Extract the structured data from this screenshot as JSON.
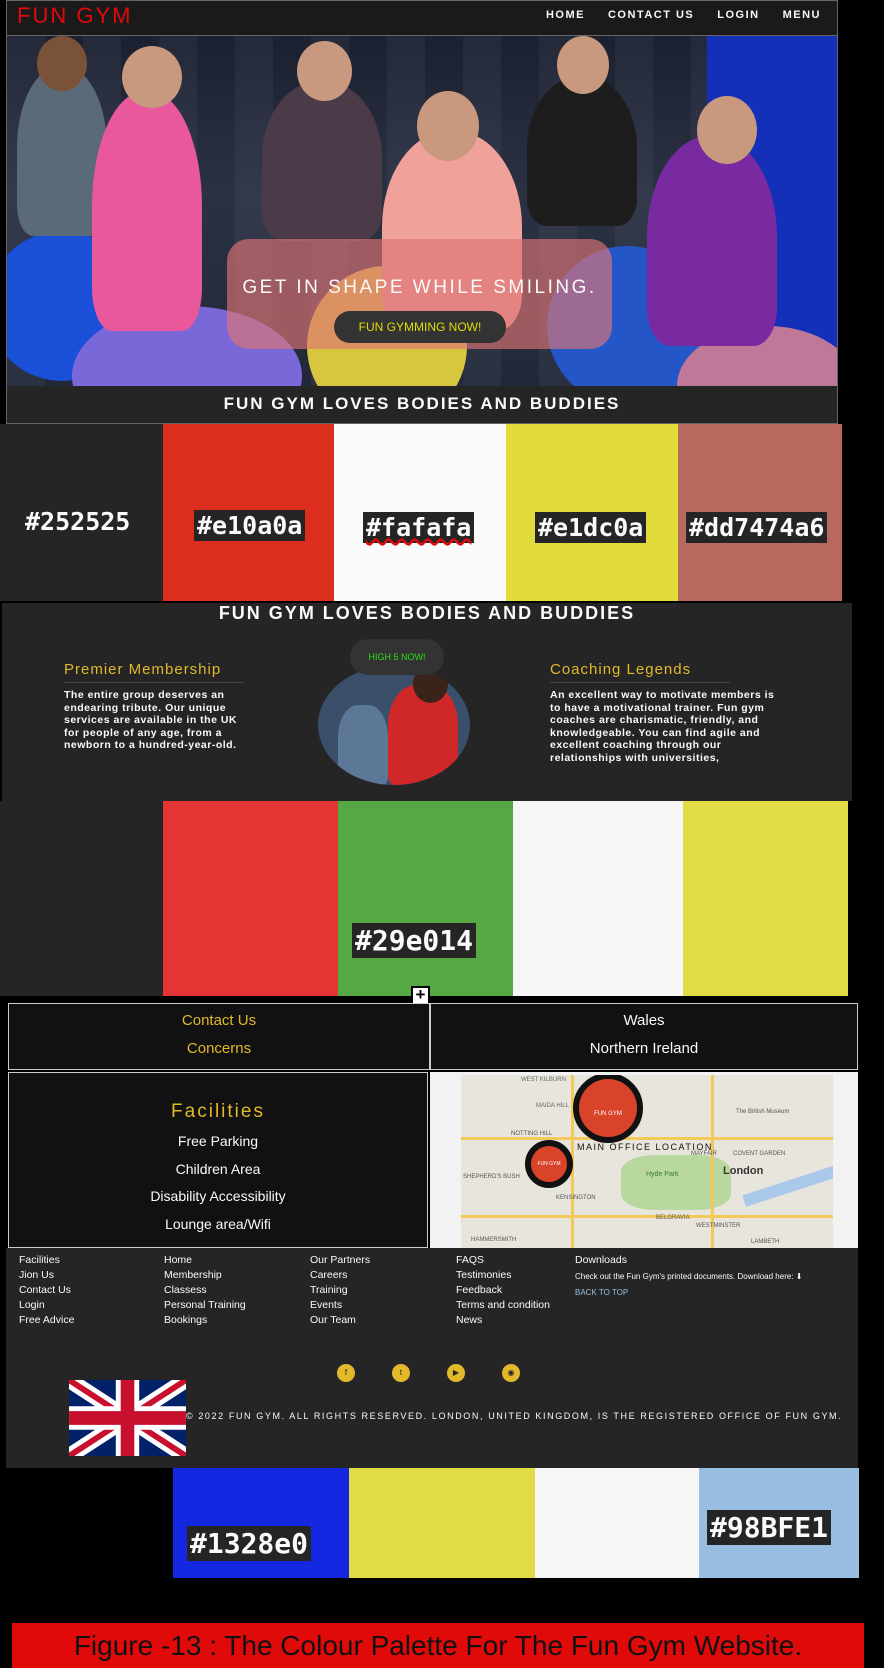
{
  "nav": {
    "logo": "FUN GYM",
    "links": [
      "HOME",
      "CONTACT US",
      "LOGIN",
      "MENU"
    ]
  },
  "hero": {
    "tagline": "GET IN SHAPE WHILE SMILING.",
    "cta_label": "FUN GYMMING NOW!",
    "strip_title": "FUN GYM LOVES BODIES AND BUDDIES"
  },
  "palette_row_1": [
    {
      "hex": "#252525",
      "color": "#252525"
    },
    {
      "hex": "#e10a0a",
      "color": "#dc2e1f"
    },
    {
      "hex": "#fafafa",
      "color": "#fafafa"
    },
    {
      "hex": "#e1dc0a",
      "color": "#e1dc3c"
    },
    {
      "hex": "#dd7474a6",
      "color": "#b9685f"
    }
  ],
  "about": {
    "title": "FUN GYM LOVES BODIES AND BUDDIES",
    "left_heading": "Premier Membership",
    "left_text": "The entire group deserves an endearing tribute. Our unique services are available in the UK for people of any age, from a newborn to a hundred-year-old.",
    "button_label": "HIGH 5 NOW!",
    "right_heading": "Coaching Legends",
    "right_text": "An excellent way to motivate members is to have a motivational trainer. Fun gym coaches are charismatic, friendly, and knowledgeable. You can find agile and excellent coaching through our relationships with universities,"
  },
  "palette_row_2": [
    {
      "hex": "",
      "color": "#e43434"
    },
    {
      "hex": "#29e014",
      "color": "#55a843"
    },
    {
      "hex": "",
      "color": "#f6f6f6"
    },
    {
      "hex": "",
      "color": "#e1dc44"
    }
  ],
  "contact": {
    "left_links": [
      "Contact Us",
      "Concerns"
    ],
    "right_links": [
      "Wales",
      "Northern Ireland"
    ]
  },
  "facilities": {
    "title": "Facilities",
    "items": [
      "Free Parking",
      "Children Area",
      "Disability Accessibility",
      "Lounge area/Wifi"
    ]
  },
  "map": {
    "pin_label": "FUN GYM",
    "office_label": "MAIN OFFICE LOCATION",
    "city_label": "London",
    "places": [
      "NOTTING HILL",
      "KENSINGTON",
      "SHEPHERD'S BUSH",
      "BELGRAVIA",
      "WESTMINSTER",
      "LAMBETH",
      "HAMMERSMITH",
      "MAYFAIR",
      "COVENT GARDEN",
      "The British Museum",
      "Hyde Park",
      "WEST KILBURN",
      "MAIDA HILL"
    ]
  },
  "footer": {
    "columns": [
      [
        "Facilities",
        "Jion Us",
        "Contact Us",
        "Login",
        "Free Advice"
      ],
      [
        "Home",
        "Membership",
        "Classess",
        "Personal Training",
        "Bookings"
      ],
      [
        "Our Partners",
        "Careers",
        "Training",
        "Events",
        "Our Team"
      ],
      [
        "FAQS",
        "Testimonies",
        "Feedback",
        "Terms and condition",
        "News"
      ]
    ],
    "downloads_title": "Downloads",
    "downloads_text": "Check out the Fun Gym's printed documents. Download here:",
    "back_to_top": "BACK TO TOP",
    "social_icons": [
      "facebook-icon",
      "twitter-icon",
      "youtube-icon",
      "instagram-icon"
    ],
    "copyright": "© 2022 FUN GYM. ALL RIGHTS RESERVED. LONDON, UNITED KINGDOM, IS THE REGISTERED OFFICE OF FUN GYM."
  },
  "palette_row_3": [
    {
      "hex": "#1328e0",
      "color": "#1328e0"
    },
    {
      "hex": "",
      "color": "#e1dc44"
    },
    {
      "hex": "",
      "color": "#f6f6f6"
    },
    {
      "hex": "#98BFE1",
      "color": "#98bfe1"
    }
  ],
  "caption": "Figure -13 : The Colour Palette For The Fun Gym Website."
}
